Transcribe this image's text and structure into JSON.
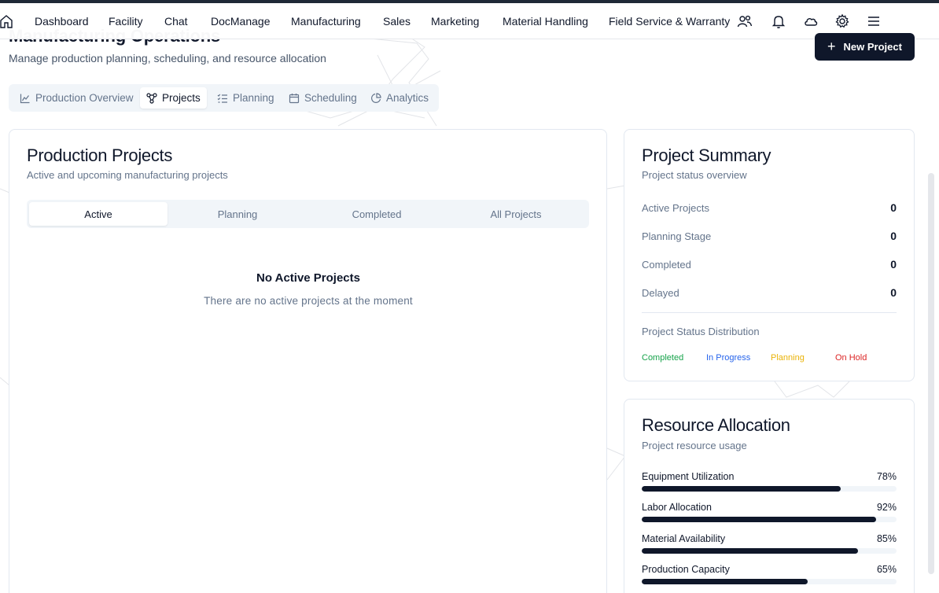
{
  "nav": {
    "items": [
      "Dashboard",
      "Facility",
      "Chat",
      "DocManage",
      "Manufacturing",
      "Sales",
      "Marketing",
      "Material Handling",
      "Field Service & Warranty"
    ],
    "icons": [
      "home-icon",
      "users-icon",
      "bell-icon",
      "cloud-icon",
      "gear-icon",
      "menu-icon"
    ]
  },
  "header": {
    "title": "Manufacturing Operations",
    "subtitle": "Manage production planning, scheduling, and resource allocation",
    "new_project_label": "New Project"
  },
  "tabs": [
    {
      "label": "Production Overview",
      "icon": "chart-line-icon",
      "active": false
    },
    {
      "label": "Projects",
      "icon": "network-icon",
      "active": true
    },
    {
      "label": "Planning",
      "icon": "checklist-icon",
      "active": false
    },
    {
      "label": "Scheduling",
      "icon": "calendar-icon",
      "active": false
    },
    {
      "label": "Analytics",
      "icon": "pie-chart-icon",
      "active": false
    }
  ],
  "projects": {
    "title": "Production Projects",
    "subtitle": "Active and upcoming manufacturing projects",
    "subtabs": [
      {
        "label": "Active",
        "active": true
      },
      {
        "label": "Planning",
        "active": false
      },
      {
        "label": "Completed",
        "active": false
      },
      {
        "label": "All Projects",
        "active": false
      }
    ],
    "empty_title": "No Active Projects",
    "empty_subtitle": "There are no active projects at the moment"
  },
  "summary": {
    "title": "Project Summary",
    "subtitle": "Project status overview",
    "stats": [
      {
        "label": "Active Projects",
        "value": "0"
      },
      {
        "label": "Planning Stage",
        "value": "0"
      },
      {
        "label": "Completed",
        "value": "0"
      },
      {
        "label": "Delayed",
        "value": "0"
      }
    ],
    "distribution_title": "Project Status Distribution",
    "legend": [
      {
        "label": "Completed",
        "color": "#16a34a"
      },
      {
        "label": "In Progress",
        "color": "#2563eb"
      },
      {
        "label": "Planning",
        "color": "#eab308"
      },
      {
        "label": "On Hold",
        "color": "#dc2626"
      }
    ]
  },
  "resources": {
    "title": "Resource Allocation",
    "subtitle": "Project resource usage",
    "items": [
      {
        "label": "Equipment Utilization",
        "value": "78%",
        "percent": 78
      },
      {
        "label": "Labor Allocation",
        "value": "92%",
        "percent": 92
      },
      {
        "label": "Material Availability",
        "value": "85%",
        "percent": 85
      },
      {
        "label": "Production Capacity",
        "value": "65%",
        "percent": 65
      }
    ]
  },
  "colors": {
    "primary": "#0f172a",
    "muted": "#64748b",
    "track": "#f1f5f9"
  }
}
